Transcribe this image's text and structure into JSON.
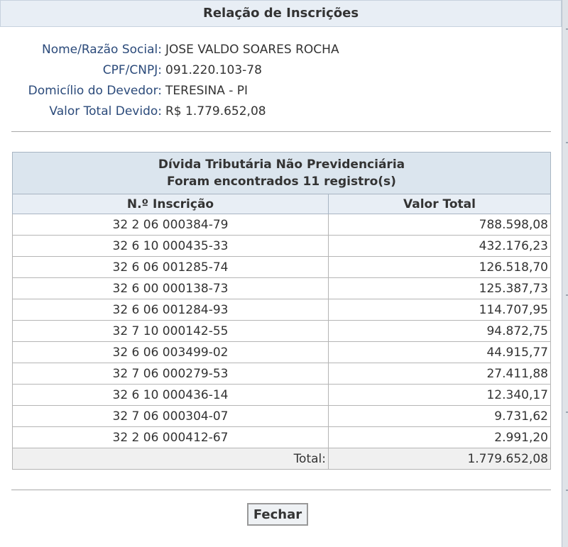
{
  "dialog": {
    "title": "Relação de Inscrições"
  },
  "debtor": {
    "fields": [
      {
        "label": "Nome/Razão Social:",
        "value": "JOSE VALDO SOARES ROCHA"
      },
      {
        "label": "CPF/CNPJ:",
        "value": "091.220.103-78"
      },
      {
        "label": "Domicílio do Devedor:",
        "value": "TERESINA - PI"
      },
      {
        "label": "Valor Total Devido:",
        "value": "R$ 1.779.652,08"
      }
    ]
  },
  "table": {
    "caption_line1": "Dívida Tributária Não Previdenciária",
    "caption_line2": "Foram encontrados 11 registro(s)",
    "columns": [
      "N.º Inscrição",
      "Valor Total"
    ],
    "rows": [
      [
        "32 2 06 000384-79",
        "788.598,08"
      ],
      [
        "32 6 10 000435-33",
        "432.176,23"
      ],
      [
        "32 6 06 001285-74",
        "126.518,70"
      ],
      [
        "32 6 00 000138-73",
        "125.387,73"
      ],
      [
        "32 6 06 001284-93",
        "114.707,95"
      ],
      [
        "32 7 10 000142-55",
        "94.872,75"
      ],
      [
        "32 6 06 003499-02",
        "44.915,77"
      ],
      [
        "32 7 06 000279-53",
        "27.411,88"
      ],
      [
        "32 6 10 000436-14",
        "12.340,17"
      ],
      [
        "32 7 06 000304-07",
        "9.731,62"
      ],
      [
        "32 2 06 000412-67",
        "2.991,20"
      ]
    ],
    "total_label": "Total:",
    "total_value": "1.779.652,08"
  },
  "actions": {
    "close_label": "Fechar"
  }
}
